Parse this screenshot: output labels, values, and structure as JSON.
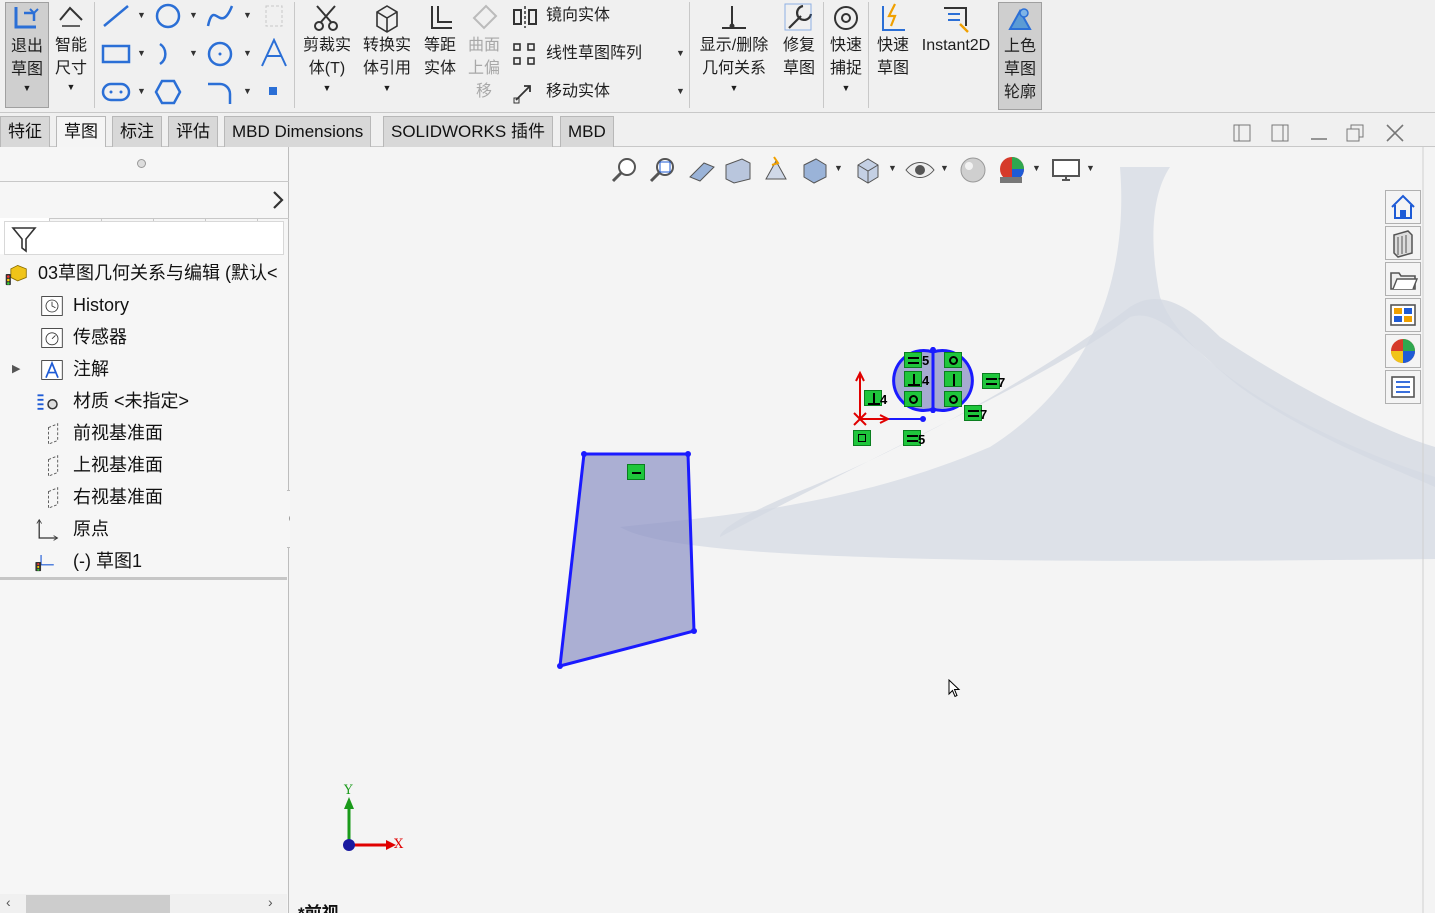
{
  "ribbon": {
    "exit_sketch": [
      "退出",
      "草图"
    ],
    "smart_dim": [
      "智能",
      "尺寸"
    ],
    "trim": [
      "剪裁实",
      "体(T)"
    ],
    "convert": [
      "转换实",
      "体引用"
    ],
    "offset": [
      "等距",
      "实体"
    ],
    "surface_offset": [
      "曲面",
      "上偏",
      "移"
    ],
    "mirror": "镜向实体",
    "linear_pattern": "线性草图阵列",
    "move": "移动实体",
    "relations": [
      "显示/删除",
      "几何关系"
    ],
    "repair": [
      "修复",
      "草图"
    ],
    "quick_snaps": [
      "快速",
      "捕捉"
    ],
    "rapid_sketch": [
      "快速",
      "草图"
    ],
    "instant2d": "Instant2D",
    "shaded_contours": [
      "上色",
      "草图",
      "轮廓"
    ]
  },
  "tabs": [
    "特征",
    "草图",
    "标注",
    "评估",
    "MBD Dimensions",
    "SOLIDWORKS 插件",
    "MBD"
  ],
  "active_tab": "草图",
  "tree": {
    "root": "03草图几何关系与编辑  (默认<",
    "items": [
      "History",
      "传感器",
      "注解",
      "材质 <未指定>",
      "前视基准面",
      "上视基准面",
      "右视基准面",
      "原点",
      "(-) 草图1"
    ]
  },
  "viewport": {
    "view_label": "*前视",
    "triad": {
      "x": "X",
      "y": "Y"
    },
    "relation_tags": [
      "5",
      "4",
      "4",
      "7",
      "7",
      "5"
    ]
  },
  "colors": {
    "sketch_blue": "#1a1aff",
    "relation_green": "#1fc63c",
    "accent_red": "#e00000"
  }
}
